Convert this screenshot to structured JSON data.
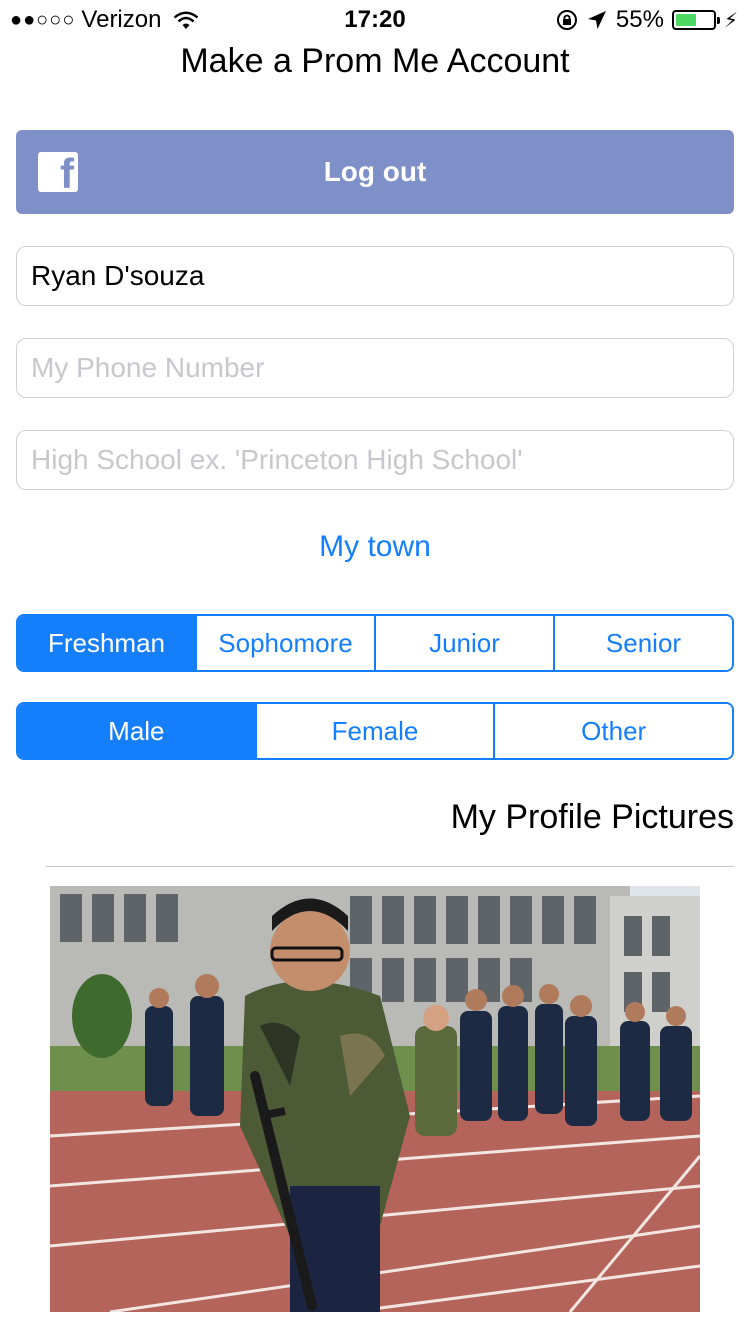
{
  "status_bar": {
    "carrier": "Verizon",
    "signal_dots": "●●○○○",
    "time": "17:20",
    "battery_percent": "55%",
    "battery_level": 0.55,
    "icons": [
      "wifi-icon",
      "rotation-lock-icon",
      "location-arrow-icon",
      "battery-icon",
      "charging-icon"
    ]
  },
  "nav": {
    "title": "Make a Prom Me Account"
  },
  "facebook": {
    "label": "Log out",
    "logo_letter": "f",
    "color": "#7f8fc8"
  },
  "form": {
    "name_value": "Ryan D'souza",
    "phone_placeholder": "My Phone Number",
    "school_placeholder": "High School ex. 'Princeton High School'"
  },
  "town_link": "My town",
  "grade_options": [
    "Freshman",
    "Sophomore",
    "Junior",
    "Senior"
  ],
  "grade_selected": "Freshman",
  "gender_options": [
    "Male",
    "Female",
    "Other"
  ],
  "gender_selected": "Male",
  "profile_section_title": "My Profile Pictures",
  "accent_color": "#147efb"
}
